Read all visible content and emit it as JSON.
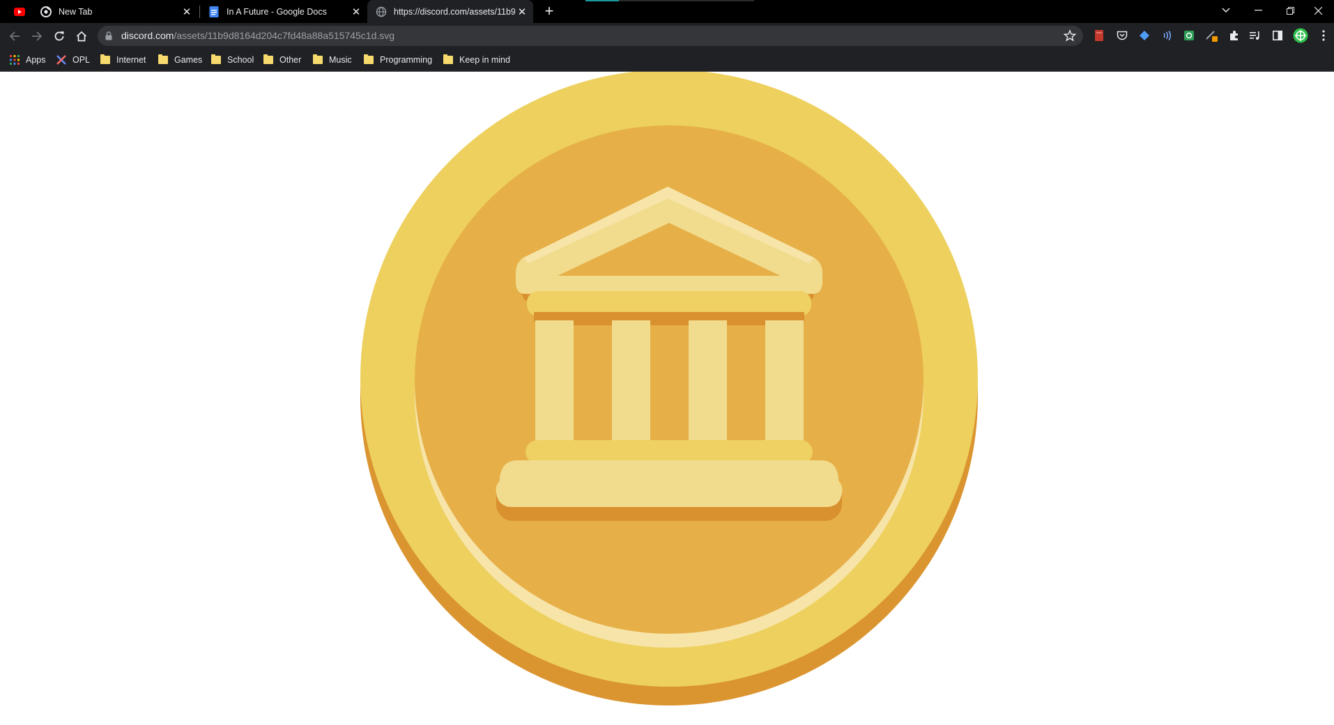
{
  "tabs": [
    {
      "title": "New Tab",
      "favicon": "chrome-icon",
      "active": false
    },
    {
      "title": "In A Future - Google Docs",
      "favicon": "google-docs-icon",
      "active": false
    },
    {
      "title": "https://discord.com/assets/11b9d8164d204c7fd48a88a515745c1d.svg",
      "favicon": "globe-icon",
      "active": true
    }
  ],
  "omnibox": {
    "host": "discord.com",
    "path": "/assets/11b9d8164d204c7fd48a88a515745c1d.svg"
  },
  "bookmarks": [
    {
      "label": "Apps",
      "icon": "apps-grid-icon"
    },
    {
      "label": "OPL",
      "icon": "opl-icon"
    },
    {
      "label": "Internet",
      "icon": "folder-icon"
    },
    {
      "label": "Games",
      "icon": "folder-icon"
    },
    {
      "label": "School",
      "icon": "folder-icon"
    },
    {
      "label": "Other",
      "icon": "folder-icon"
    },
    {
      "label": "Music",
      "icon": "folder-icon"
    },
    {
      "label": "Programming",
      "icon": "folder-icon"
    },
    {
      "label": "Keep in mind",
      "icon": "folder-icon"
    }
  ],
  "colors": {
    "coin_outer": "#edd05e",
    "coin_rim_shadow": "#db9530",
    "coin_inner": "#e6af48",
    "coin_highlight": "#f7e4a8",
    "building_light": "#f1dc8e",
    "building_mid": "#efd062",
    "building_shadow": "#d9912f"
  }
}
